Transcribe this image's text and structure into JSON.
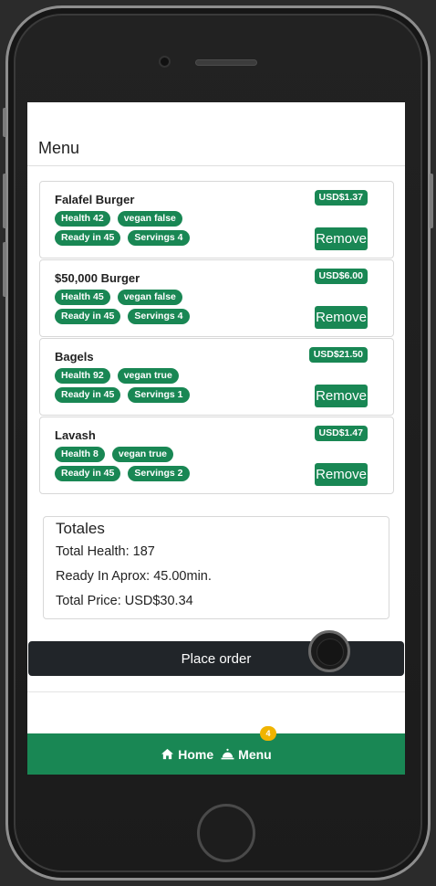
{
  "header": {
    "title": "Menu"
  },
  "items": [
    {
      "name": "Falafel Burger",
      "health": "Health 42",
      "vegan": "vegan false",
      "ready": "Ready in 45",
      "servings": "Servings 4",
      "price": "USD$1.37",
      "remove_label": "Remove"
    },
    {
      "name": "$50,000 Burger",
      "health": "Health 45",
      "vegan": "vegan false",
      "ready": "Ready in 45",
      "servings": "Servings 4",
      "price": "USD$6.00",
      "remove_label": "Remove"
    },
    {
      "name": "Bagels",
      "health": "Health 92",
      "vegan": "vegan true",
      "ready": "Ready in 45",
      "servings": "Servings 1",
      "price": "USD$21.50",
      "remove_label": "Remove"
    },
    {
      "name": "Lavash",
      "health": "Health 8",
      "vegan": "vegan true",
      "ready": "Ready in 45",
      "servings": "Servings 2",
      "price": "USD$1.47",
      "remove_label": "Remove"
    }
  ],
  "totals": {
    "title": "Totales",
    "health": "Total Health: 187",
    "ready": "Ready In Aprox: 45.00min.",
    "price": "Total Price: USD$30.34"
  },
  "actions": {
    "place_order_label": "Place order"
  },
  "nav": {
    "home_label": "Home",
    "menu_label": "Menu",
    "menu_count": "4"
  },
  "colors": {
    "accent": "#198754",
    "dark": "#212529",
    "badge_warning": "#f0b400"
  },
  "icons": {
    "home": "home-icon",
    "menu": "food-bell-icon"
  }
}
